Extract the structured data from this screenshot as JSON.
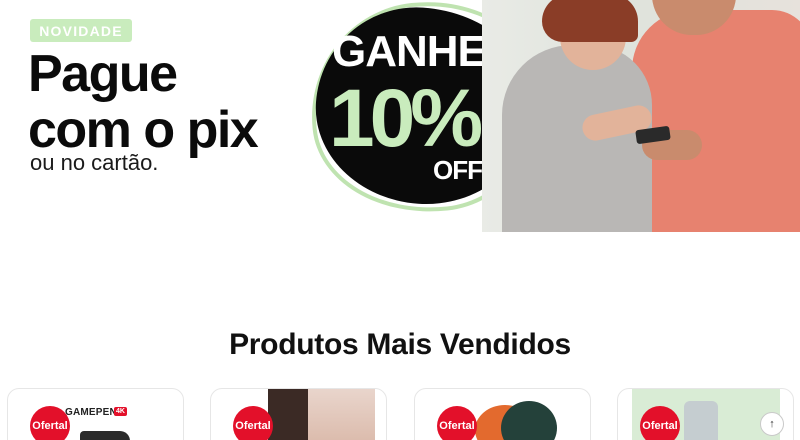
{
  "hero": {
    "badge": "NOVIDADE",
    "headline_line1": "Pague",
    "headline_line2": "com o pix",
    "subline": "ou no cartão.",
    "promo": {
      "line1": "GANHE",
      "line2": "10%",
      "line3": "OFF"
    }
  },
  "section": {
    "title": "Produtos Mais Vendidos"
  },
  "products": [
    {
      "tag": "Ofertal",
      "brand": "GAMEPEN",
      "brand_tag": "4K"
    },
    {
      "tag": "Ofertal"
    },
    {
      "tag": "Ofertal"
    },
    {
      "tag": "Ofertal"
    }
  ],
  "scroll_top": {
    "icon": "arrow-up-icon",
    "glyph": "↑"
  },
  "colors": {
    "badge_bg": "#c9ecbd",
    "promo_green": "#c9ecbd",
    "offer_red": "#e3102a",
    "text_dark": "#111111"
  }
}
